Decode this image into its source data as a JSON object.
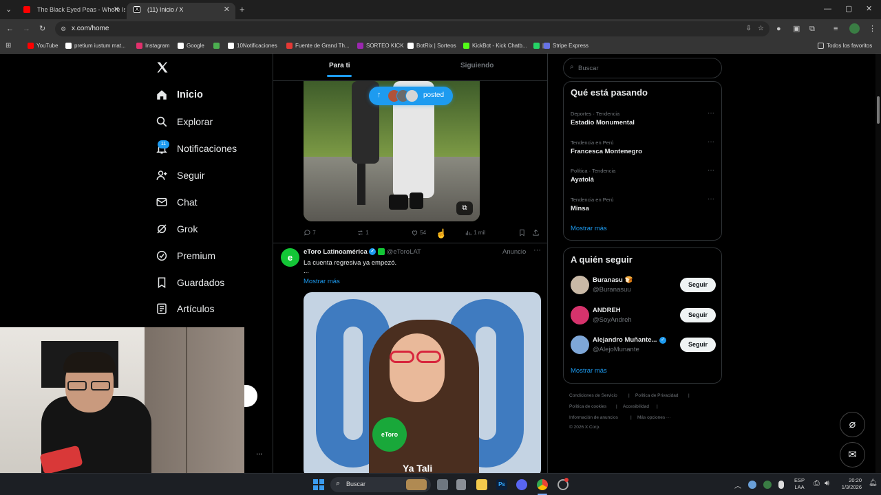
{
  "browser": {
    "tabs": [
      {
        "title": "The Black Eyed Peas - Where Is",
        "favicon_color": "#ff0000"
      },
      {
        "title": "(11) Inicio / X",
        "favicon_color": "#ffffff"
      }
    ],
    "url": "x.com/home",
    "bookmarks": [
      {
        "label": "YouTube",
        "color": "#ff0000"
      },
      {
        "label": "pretium iustum mat...",
        "color": "#ffffff"
      },
      {
        "label": "Instagram",
        "color": "#e1306c"
      },
      {
        "label": "Google",
        "color": "#ffffff"
      },
      {
        "label": "",
        "color": "#4caf50"
      },
      {
        "label": "10Notificaciones",
        "color": "#ffffff"
      },
      {
        "label": "Fuente de Grand Th...",
        "color": "#e53935"
      },
      {
        "label": "SORTEO KICK",
        "color": "#9c27b0"
      },
      {
        "label": "BotRix | Sorteos",
        "color": "#ffffff"
      },
      {
        "label": "KickBot - Kick Chatb...",
        "color": "#53fc18"
      },
      {
        "label": "|",
        "color": "#25d366"
      },
      {
        "label": "Stripe Express",
        "color": "#6772e5"
      }
    ],
    "all_bookmarks": "Todos los favoritos"
  },
  "sidebar": {
    "logo": "X",
    "notif_badge": "11",
    "items": [
      {
        "label": "Inicio",
        "icon": "home-icon"
      },
      {
        "label": "Explorar",
        "icon": "search-icon"
      },
      {
        "label": "Notificaciones",
        "icon": "bell-icon"
      },
      {
        "label": "Seguir",
        "icon": "person-add-icon"
      },
      {
        "label": "Chat",
        "icon": "mail-icon"
      },
      {
        "label": "Grok",
        "icon": "grok-icon"
      },
      {
        "label": "Premium",
        "icon": "verified-icon"
      },
      {
        "label": "Guardados",
        "icon": "bookmark-icon"
      },
      {
        "label": "Artículos",
        "icon": "article-icon"
      }
    ],
    "more_dots": "..."
  },
  "feed": {
    "tabs": [
      "Para ti",
      "Siguiendo"
    ],
    "new_posts_pill": "posted",
    "post1": {
      "replies": "7",
      "reposts": "1",
      "likes": "54",
      "views": "1 mil"
    },
    "ad": {
      "name": "eToro Latinoamérica",
      "handle": "@eToroLAT",
      "tag": "Anuncio",
      "text": "La cuenta regresiva ya empezó.",
      "ellipsis": "...",
      "more": "Mostrar más",
      "mic_label": "eToro",
      "caption": "Ya Tali"
    }
  },
  "right": {
    "search_placeholder": "Buscar",
    "trends_title": "Qué está pasando",
    "trends": [
      {
        "meta": "Deportes · Tendencia",
        "name": "Estadio Monumental"
      },
      {
        "meta": "Tendencia en Perú",
        "name": "Francesca Montenegro"
      },
      {
        "meta": "Política · Tendencia",
        "name": "Ayatolá"
      },
      {
        "meta": "Tendencia en Perú",
        "name": "Minsa"
      }
    ],
    "trends_more": "Mostrar más",
    "follow_title": "A quién seguir",
    "follow": [
      {
        "name": "Buranasu 🍞",
        "handle": "@Buranasuu",
        "button": "Seguir",
        "color": "#c9b9a6"
      },
      {
        "name": "ANDREH",
        "handle": "@SoyAndreh",
        "button": "Seguir",
        "color": "#d6336c"
      },
      {
        "name": "Alejandro Muñante...",
        "handle": "@AlejoMunante",
        "button": "Seguir",
        "color": "#7ea7d8"
      }
    ],
    "follow_more": "Mostrar más",
    "footer": [
      "Condiciones de Servicio",
      "|",
      "Política de Privacidad",
      "|",
      "Política de cookies",
      "|",
      "Accesibilidad",
      "|",
      "Información de anuncios",
      "|",
      "Más opciones ···",
      "© 2026 X Corp."
    ]
  },
  "taskbar": {
    "search": "Buscar",
    "lang1": "ESP",
    "lang2": "LAA",
    "time": "20:20",
    "date": "1/3/2026"
  },
  "colors": {
    "accent": "#1d9bf0",
    "bg": "#000000",
    "border": "#2f3336"
  }
}
